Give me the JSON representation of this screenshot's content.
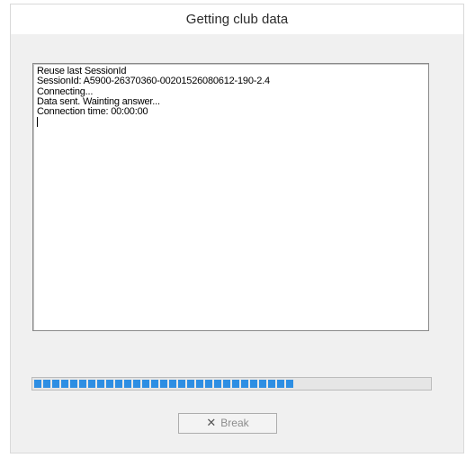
{
  "window": {
    "title": "Getting club data"
  },
  "log": {
    "lines": [
      "Reuse last SessionId",
      "SessionId: A5900-26370360-00201526080612-190-2.4",
      "Connecting...",
      "Data sent. Wainting answer...",
      "Connection time: 00:00:00"
    ]
  },
  "progress": {
    "fraction": 0.66,
    "color": "#2d8ee3"
  },
  "buttons": {
    "break_label": "Break",
    "break_icon": "x-icon",
    "break_icon_glyph": "✕"
  }
}
